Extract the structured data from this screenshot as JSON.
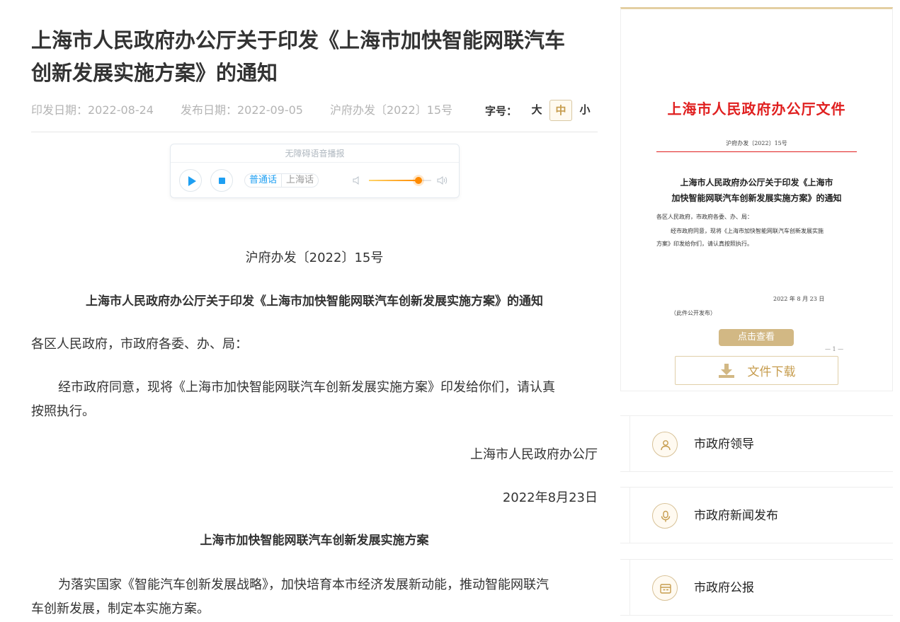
{
  "article": {
    "title_line1": "上海市人民政府办公厅关于印发《上海市加快智能网联汽车",
    "title_line2": "创新发展实施方案》的通知",
    "issue_date": "印发日期：2022-08-24",
    "publish_date": "发布日期：2022-09-05",
    "doc_number": "沪府办发〔2022〕15号",
    "font_size": {
      "label": "字号：",
      "large": "大",
      "medium": "中",
      "small": "小",
      "selected": "中"
    }
  },
  "audio_player": {
    "title": "无障碍语音播报",
    "lang_mandarin": "普通话",
    "lang_shanghai": "上海话",
    "volume": 0.8,
    "accent": "#1e9ff2"
  },
  "content": {
    "doc_number": "沪府办发〔2022〕15号",
    "notice_title": "上海市人民政府办公厅关于印发《上海市加快智能网联汽车创新发展实施方案》的通知",
    "salutation": "各区人民政府，市政府各委、办、局：",
    "para1_line1": "经市政府同意，现将《上海市加快智能网联汽车创新发展实施方案》印发给你们，请认真",
    "para1_line2": "按照执行。",
    "signer": "上海市人民政府办公厅",
    "date": "2022年8月23日",
    "plan_title": "上海市加快智能网联汽车创新发展实施方案",
    "para2_line1": "为落实国家《智能汽车创新发展战略》，加快培育本市经济发展新动能，推动智能网联汽",
    "para2_line2": "车创新发展，制定本实施方案。"
  },
  "doc_preview": {
    "header": "上海市人民政府办公厅文件",
    "number": "沪府办发〔2022〕15号",
    "title_line1": "上海市人民政府办公厅关于印发《上海市",
    "title_line2": "加快智能网联汽车创新发展实施方案》的通知",
    "salutation": "各区人民政府，市政府各委、办、局：",
    "body_line1": "经市政府同意，现将《上海市加快智能网联汽车创新发展实施",
    "body_line2": "方案》印发给你们，请认真按照执行。",
    "date": "2022 年 8 月 23 日",
    "publish_note": "（此件公开发布）",
    "page_num": "— 1 —",
    "view_button": "点击查看",
    "download_button": "文件下载",
    "brand_red": "#e02020",
    "gold": "#c69c4d"
  },
  "sidebar": {
    "items": [
      {
        "label": "市政府领导",
        "icon": "person-icon"
      },
      {
        "label": "市政府新闻发布",
        "icon": "microphone-icon"
      },
      {
        "label": "市政府公报",
        "icon": "bulletin-icon"
      }
    ]
  }
}
